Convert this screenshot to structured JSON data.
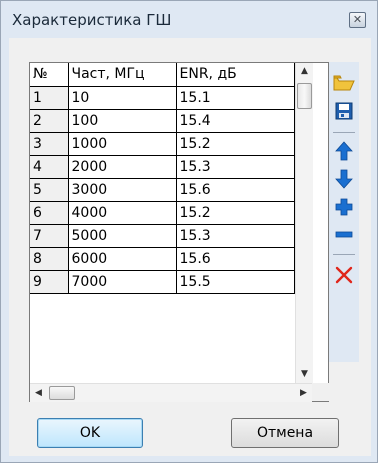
{
  "window": {
    "title": "Характеристика ГШ",
    "close_glyph": "✕"
  },
  "table": {
    "columns": [
      "№",
      "Част, МГц",
      "ENR, дБ"
    ],
    "rows": [
      [
        "1",
        "10",
        "15.1"
      ],
      [
        "2",
        "100",
        "15.4"
      ],
      [
        "3",
        "1000",
        "15.2"
      ],
      [
        "4",
        "2000",
        "15.3"
      ],
      [
        "5",
        "3000",
        "15.6"
      ],
      [
        "6",
        "4000",
        "15.2"
      ],
      [
        "7",
        "5000",
        "15.3"
      ],
      [
        "8",
        "6000",
        "15.6"
      ],
      [
        "9",
        "7000",
        "15.5"
      ]
    ]
  },
  "toolbar": {
    "open_icon": "folder-open-icon",
    "save_icon": "floppy-save-icon",
    "move_up_icon": "arrow-up-icon",
    "move_down_icon": "arrow-down-icon",
    "add_icon": "plus-icon",
    "remove_icon": "minus-icon",
    "delete_icon": "red-x-icon"
  },
  "buttons": {
    "ok_label": "OK",
    "cancel_label": "Отмена"
  },
  "colors": {
    "accent_blue": "#1a6fd0",
    "delete_red": "#e0261b",
    "folder_yellow": "#f0c33c"
  }
}
